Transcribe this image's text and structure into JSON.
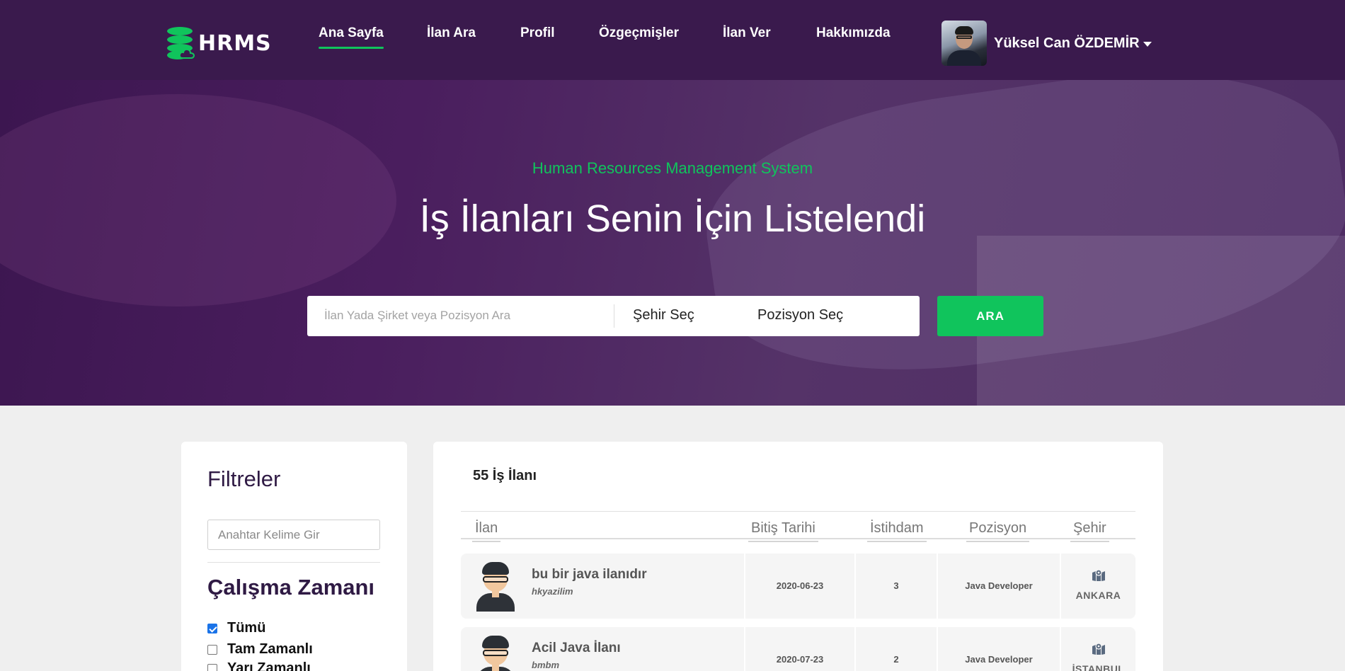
{
  "navbar": {
    "logo_text": "HRMS",
    "links": [
      "Ana Sayfa",
      "İlan Ara",
      "Profil",
      "Özgeçmişler",
      "İlan Ver",
      "Hakkımızda"
    ],
    "active_link": "Ana Sayfa",
    "user_name": "Yüksel Can ÖZDEMİR"
  },
  "hero": {
    "subtitle": "Human Resources Management System",
    "title": "İş İlanları Senin İçin Listelendi",
    "search_placeholder": "İlan Yada Şirket veya Pozisyon Ara",
    "city_select": "Şehir Seç",
    "position_select": "Pozisyon Seç",
    "search_button": "ARA"
  },
  "filters": {
    "title": "Filtreler",
    "keyword_placeholder": "Anahtar Kelime Gir",
    "work_time_title": "Çalışma Zamanı",
    "options": [
      {
        "label": "Tümü",
        "checked": true
      },
      {
        "label": "Tam Zamanlı",
        "checked": false
      },
      {
        "label": "Yarı Zamanlı",
        "checked": false
      }
    ]
  },
  "jobs": {
    "count_label": "55 İş İlanı",
    "columns": [
      "İlan",
      "Bitiş Tarihi",
      "İstihdam",
      "Pozisyon",
      "Şehir"
    ],
    "rows": [
      {
        "title": "bu bir java ilanıdır",
        "company": "hkyazilim",
        "end_date": "2020-06-23",
        "employment": "3",
        "position": "Java Developer",
        "city": "ANKARA"
      },
      {
        "title": "Acil Java İlanı",
        "company": "bmbm",
        "end_date": "2020-07-23",
        "employment": "2",
        "position": "Java Developer",
        "city": "İSTANBUL"
      }
    ]
  },
  "colors": {
    "nav_bg": "#3a1a4d",
    "accent_green": "#10c45c",
    "heading_purple": "#2f1a44"
  }
}
